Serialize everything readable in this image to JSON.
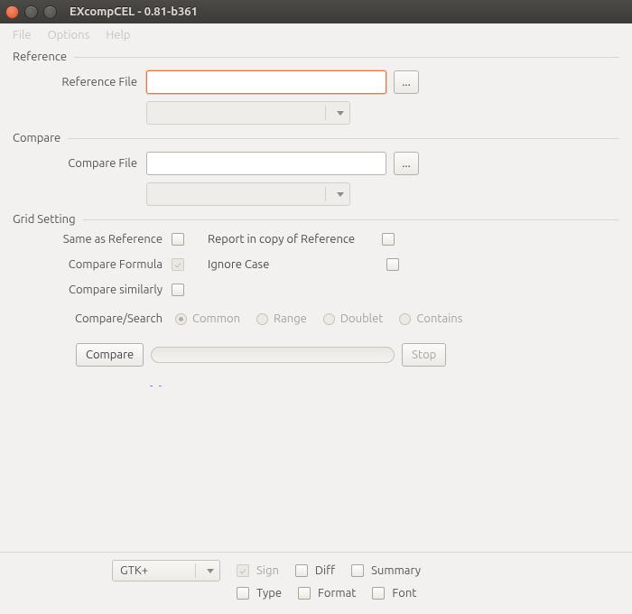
{
  "window": {
    "title": "EXcompCEL - 0.81-b361"
  },
  "menu": {
    "file": "File",
    "options": "Options",
    "help": "Help"
  },
  "groups": {
    "reference": {
      "title": "Reference",
      "file_label": "Reference File",
      "file_value": "",
      "browse": "...",
      "combo_value": ""
    },
    "compare": {
      "title": "Compare",
      "file_label": "Compare File",
      "file_value": "",
      "browse": "...",
      "combo_value": ""
    },
    "grid": {
      "title": "Grid Setting",
      "same_as_ref": "Same as Reference",
      "report_copy": "Report in copy of Reference",
      "compare_formula": "Compare Formula",
      "ignore_case": "Ignore Case",
      "compare_similarly": "Compare similarly",
      "compare_search": "Compare/Search",
      "radios": {
        "common": "Common",
        "range": "Range",
        "doublet": "Doublet",
        "contains": "Contains"
      }
    }
  },
  "actions": {
    "compare": "Compare",
    "stop": "Stop",
    "link": "- -"
  },
  "bottom": {
    "theme": "GTK+",
    "sign": "Sign",
    "diff": "Diff",
    "summary": "Summary",
    "type": "Type",
    "format": "Format",
    "font": "Font"
  }
}
